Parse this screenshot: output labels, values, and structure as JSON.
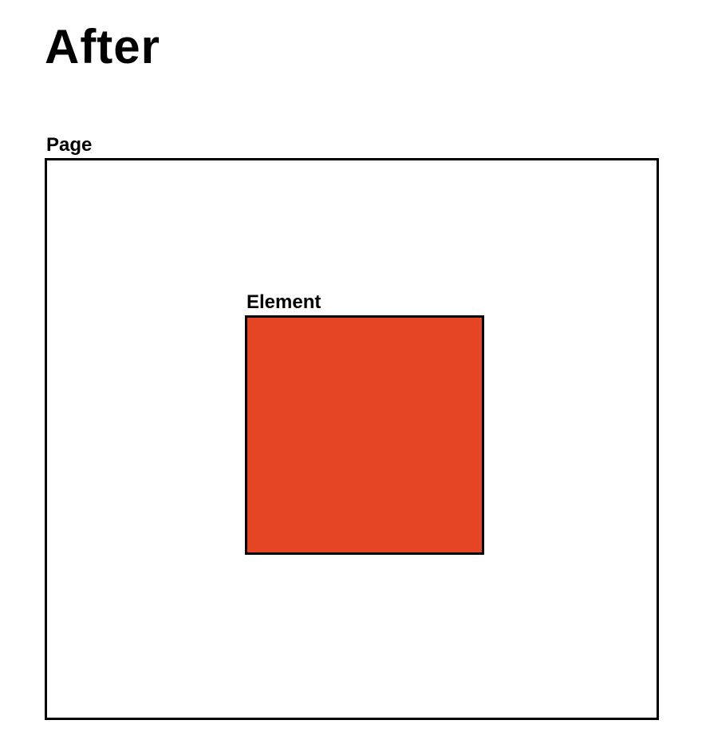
{
  "title": "After",
  "page_label": "Page",
  "element_label": "Element",
  "element_color": "#e64525"
}
